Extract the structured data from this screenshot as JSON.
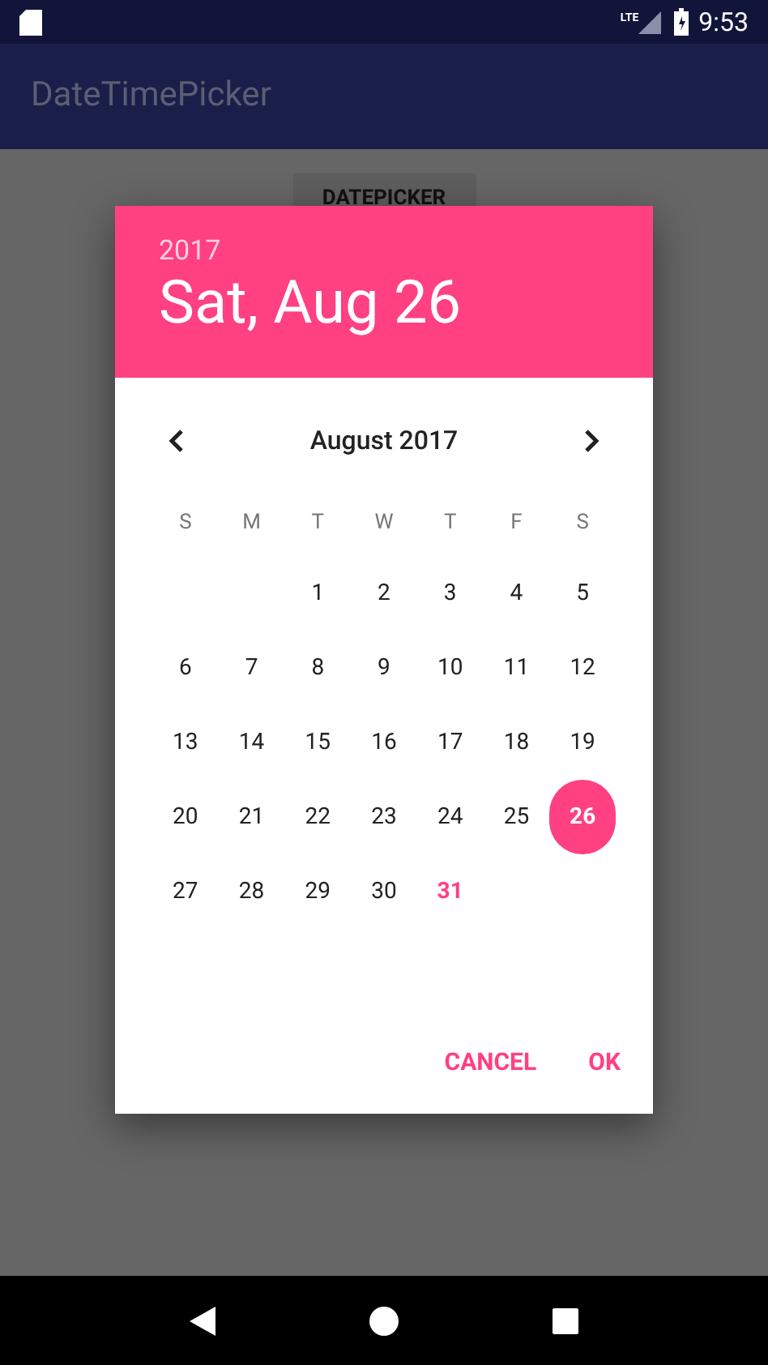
{
  "status_bar": {
    "network": "LTE",
    "time": "9:53"
  },
  "app_bar": {
    "title": "DateTimePicker"
  },
  "background_button": {
    "label": "DATEPICKER"
  },
  "dialog": {
    "year": "2017",
    "date": "Sat, Aug 26",
    "month": "August 2017",
    "weekdays": [
      "S",
      "M",
      "T",
      "W",
      "T",
      "F",
      "S"
    ],
    "weeks": [
      [
        {
          "kind": "empty"
        },
        {
          "kind": "empty"
        },
        {
          "kind": "day",
          "label": "1",
          "selected": false,
          "today": false
        },
        {
          "kind": "day",
          "label": "2",
          "selected": false,
          "today": false
        },
        {
          "kind": "day",
          "label": "3",
          "selected": false,
          "today": false
        },
        {
          "kind": "day",
          "label": "4",
          "selected": false,
          "today": false
        },
        {
          "kind": "day",
          "label": "5",
          "selected": false,
          "today": false
        }
      ],
      [
        {
          "kind": "day",
          "label": "6",
          "selected": false,
          "today": false
        },
        {
          "kind": "day",
          "label": "7",
          "selected": false,
          "today": false
        },
        {
          "kind": "day",
          "label": "8",
          "selected": false,
          "today": false
        },
        {
          "kind": "day",
          "label": "9",
          "selected": false,
          "today": false
        },
        {
          "kind": "day",
          "label": "10",
          "selected": false,
          "today": false
        },
        {
          "kind": "day",
          "label": "11",
          "selected": false,
          "today": false
        },
        {
          "kind": "day",
          "label": "12",
          "selected": false,
          "today": false
        }
      ],
      [
        {
          "kind": "day",
          "label": "13",
          "selected": false,
          "today": false
        },
        {
          "kind": "day",
          "label": "14",
          "selected": false,
          "today": false
        },
        {
          "kind": "day",
          "label": "15",
          "selected": false,
          "today": false
        },
        {
          "kind": "day",
          "label": "16",
          "selected": false,
          "today": false
        },
        {
          "kind": "day",
          "label": "17",
          "selected": false,
          "today": false
        },
        {
          "kind": "day",
          "label": "18",
          "selected": false,
          "today": false
        },
        {
          "kind": "day",
          "label": "19",
          "selected": false,
          "today": false
        }
      ],
      [
        {
          "kind": "day",
          "label": "20",
          "selected": false,
          "today": false
        },
        {
          "kind": "day",
          "label": "21",
          "selected": false,
          "today": false
        },
        {
          "kind": "day",
          "label": "22",
          "selected": false,
          "today": false
        },
        {
          "kind": "day",
          "label": "23",
          "selected": false,
          "today": false
        },
        {
          "kind": "day",
          "label": "24",
          "selected": false,
          "today": false
        },
        {
          "kind": "day",
          "label": "25",
          "selected": false,
          "today": false
        },
        {
          "kind": "day",
          "label": "26",
          "selected": true,
          "today": false
        }
      ],
      [
        {
          "kind": "day",
          "label": "27",
          "selected": false,
          "today": false
        },
        {
          "kind": "day",
          "label": "28",
          "selected": false,
          "today": false
        },
        {
          "kind": "day",
          "label": "29",
          "selected": false,
          "today": false
        },
        {
          "kind": "day",
          "label": "30",
          "selected": false,
          "today": false
        },
        {
          "kind": "day",
          "label": "31",
          "selected": false,
          "today": true
        }
      ]
    ],
    "buttons": [
      "CANCEL",
      "OK"
    ]
  }
}
